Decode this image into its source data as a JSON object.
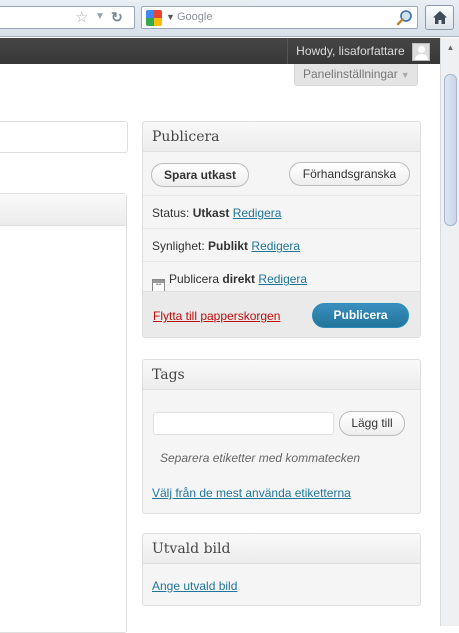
{
  "browser": {
    "search_placeholder": "Google",
    "star_icon": "star-icon",
    "reload_icon": "reload-icon",
    "home_icon": "home-icon"
  },
  "adminbar": {
    "greeting": "Howdy, lisaforfattare"
  },
  "screen_options": {
    "label": "Panelinställningar"
  },
  "publish_box": {
    "title": "Publicera",
    "save_draft": "Spara utkast",
    "preview": "Förhandsgranska",
    "status_label": "Status:",
    "status_value": "Utkast",
    "status_edit": "Redigera",
    "visibility_label": "Synlighet:",
    "visibility_value": "Publikt",
    "visibility_edit": "Redigera",
    "schedule_label": "Publicera",
    "schedule_value": "direkt",
    "schedule_edit": "Redigera",
    "trash": "Flytta till papperskorgen",
    "publish": "Publicera"
  },
  "tags_box": {
    "title": "Tags",
    "add_button": "Lägg till",
    "hint": "Separera etiketter med kommatecken",
    "choose_link": "Välj från de mest använda etiketterna"
  },
  "featured_box": {
    "title": "Utvald bild",
    "set_link": "Ange utvald bild"
  },
  "colors": {
    "link": "#21759b",
    "trash": "#bc0b0b",
    "primary_button": "#21759b",
    "adminbar": "#464646"
  }
}
